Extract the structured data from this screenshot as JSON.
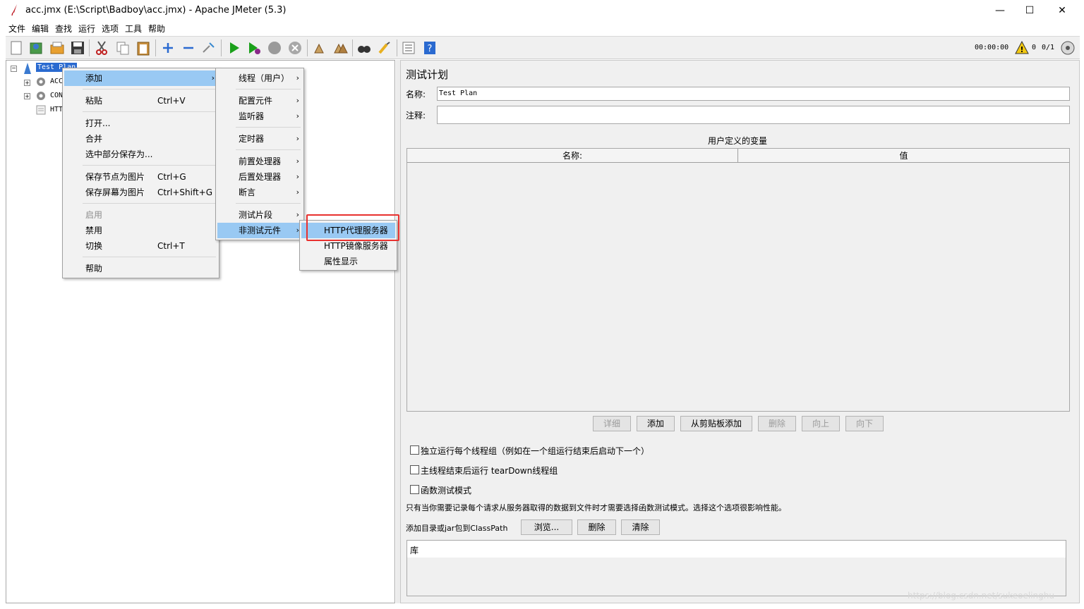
{
  "window": {
    "title": "acc.jmx (E:\\Script\\Badboy\\acc.jmx) - Apache JMeter (5.3)",
    "minimize": "—",
    "maximize": "☐",
    "close": "✕"
  },
  "menubar": [
    "文件",
    "编辑",
    "查找",
    "运行",
    "选项",
    "工具",
    "帮助"
  ],
  "toolbar": {
    "timer": "00:00:00",
    "warnings": "0",
    "threads": "0/1",
    "icons": [
      "new-icon",
      "templates-icon",
      "open-icon",
      "save-icon",
      "cut-icon",
      "copy-icon",
      "paste-icon",
      "expand-icon",
      "collapse-icon",
      "toggle-icon",
      "start-icon",
      "start-no-pause-icon",
      "stop-icon",
      "shutdown-icon",
      "clear-icon",
      "clear-all-icon",
      "search-icon",
      "reset-search-icon",
      "function-helper-icon",
      "help-icon"
    ]
  },
  "tree": {
    "root": "Test Plan",
    "children": [
      "ACC",
      "CON",
      "HTT"
    ]
  },
  "context_menu": {
    "items": [
      {
        "label": "添加",
        "accel": "",
        "submenu": true,
        "selected": true
      },
      {
        "label": "粘贴",
        "accel": "Ctrl+V"
      },
      {
        "label": "打开...",
        "accel": ""
      },
      {
        "label": "合并",
        "accel": ""
      },
      {
        "label": "选中部分保存为...",
        "accel": ""
      },
      {
        "label": "保存节点为图片",
        "accel": "Ctrl+G"
      },
      {
        "label": "保存屏幕为图片",
        "accel": "Ctrl+Shift+G"
      },
      {
        "label": "启用",
        "accel": "",
        "disabled": true
      },
      {
        "label": "禁用",
        "accel": ""
      },
      {
        "label": "切换",
        "accel": "Ctrl+T"
      },
      {
        "label": "帮助",
        "accel": ""
      }
    ]
  },
  "add_submenu": {
    "items": [
      "线程（用户）",
      "配置元件",
      "监听器",
      "定时器",
      "前置处理器",
      "后置处理器",
      "断言",
      "测试片段",
      "非测试元件"
    ]
  },
  "non_test_submenu": {
    "items": [
      "HTTP代理服务器",
      "HTTP镜像服务器",
      "属性显示"
    ],
    "highlight_color": "#e8312f"
  },
  "test_plan": {
    "heading": "测试计划",
    "name_label": "名称:",
    "name_value": "Test Plan",
    "comment_label": "注释:",
    "comment_value": "",
    "vars_title": "用户定义的变量",
    "col_name": "名称:",
    "col_value": "值",
    "buttons": {
      "detail": "详细",
      "add": "添加",
      "add_clipboard": "从剪贴板添加",
      "delete": "删除",
      "up": "向上",
      "down": "向下"
    },
    "checkboxes": [
      {
        "label": "独立运行每个线程组（例如在一个组运行结束后启动下一个）",
        "checked": false
      },
      {
        "label": "主线程结束后运行 tearDown线程组",
        "checked": false
      },
      {
        "label": "函数测试模式",
        "checked": false
      }
    ],
    "functional_note": "只有当你需要记录每个请求从服务器取得的数据到文件时才需要选择函数测试模式。选择这个选项很影响性能。",
    "classpath_label": "添加目录或jar包到ClassPath",
    "browse": "浏览...",
    "cp_delete": "删除",
    "cp_clear": "清除",
    "library_header": "库"
  },
  "watermark": "https://blog.csdn.net/sukeoelinghu"
}
